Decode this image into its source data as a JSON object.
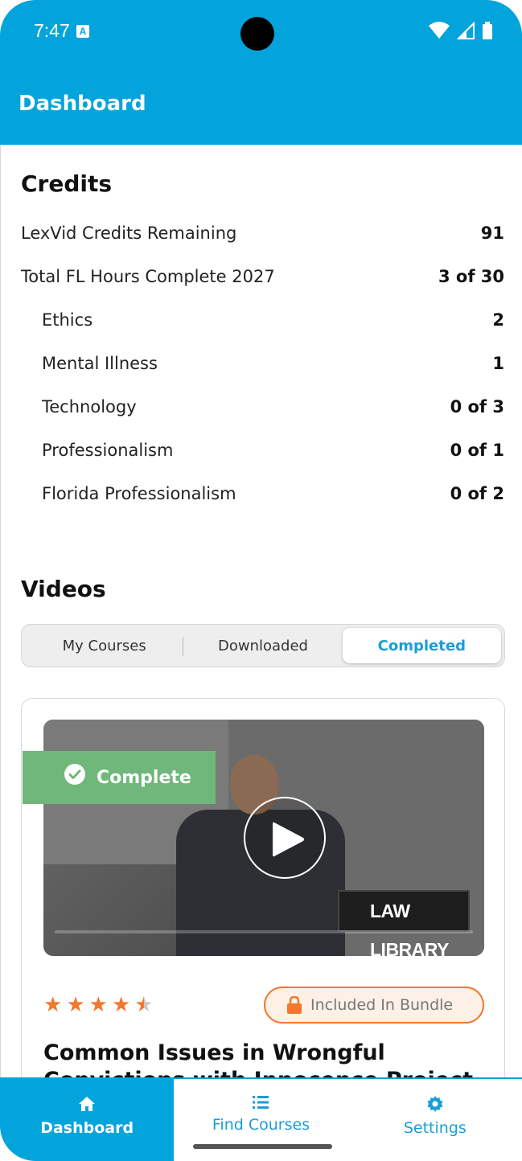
{
  "status_bar": {
    "time": "7:47",
    "a_icon": "A"
  },
  "app_bar": {
    "title": "Dashboard"
  },
  "credits": {
    "title": "Credits",
    "rows": [
      {
        "label": "LexVid Credits Remaining",
        "value": "91"
      },
      {
        "label": "Total FL Hours Complete 2027",
        "value": "3 of 30"
      },
      {
        "label": "Ethics",
        "value": "2"
      },
      {
        "label": "Mental Illness",
        "value": "1"
      },
      {
        "label": "Technology",
        "value": "0 of 3"
      },
      {
        "label": "Professionalism",
        "value": "0 of 1"
      },
      {
        "label": "Florida Professionalism",
        "value": "0 of 2"
      }
    ]
  },
  "videos": {
    "title": "Videos",
    "tabs": [
      "My Courses",
      "Downloaded",
      "Completed"
    ],
    "active_tab": "Completed"
  },
  "course_card": {
    "badge": "Complete",
    "thumbnail_sign": "LAW LIBRARY",
    "rating": 4.5,
    "bundle_label": "Included In Bundle",
    "title": "Common Issues in Wrongful Convictions with Innocence Project"
  },
  "bottom_nav": [
    {
      "label": "Dashboard",
      "icon": "home-icon",
      "active": true
    },
    {
      "label": "Find Courses",
      "icon": "list-icon",
      "active": false
    },
    {
      "label": "Settings",
      "icon": "gear-icon",
      "active": false
    }
  ],
  "colors": {
    "primary": "#03A4DB",
    "accent": "#F2782D",
    "complete": "#6FB77A"
  }
}
